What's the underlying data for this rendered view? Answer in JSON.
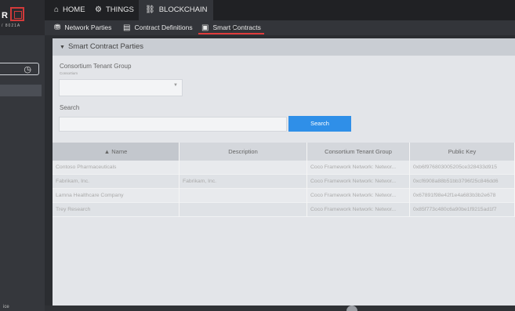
{
  "brand": {
    "letter": "R",
    "subtitle": "/ 8021A"
  },
  "top_nav": {
    "tabs": [
      {
        "label": "HOME",
        "icon": "home-icon",
        "glyph": "⌂"
      },
      {
        "label": "THINGS",
        "icon": "things-icon",
        "glyph": "⚙"
      },
      {
        "label": "BLOCKCHAIN",
        "icon": "blockchain-icon",
        "glyph": "⛓"
      }
    ]
  },
  "sub_nav": {
    "tabs": [
      {
        "label": "Network Parties",
        "icon": "network-parties-icon",
        "glyph": "⛃"
      },
      {
        "label": "Contract Definitions",
        "icon": "contract-definitions-icon",
        "glyph": "▤"
      },
      {
        "label": "Smart Contracts",
        "icon": "smart-contracts-icon",
        "glyph": "▣"
      }
    ]
  },
  "section": {
    "title": "Smart Contract Parties"
  },
  "consortium": {
    "label": "Consortium Tenant Group",
    "sublabel": "Consortium",
    "value": ""
  },
  "search": {
    "label": "Search",
    "value": "",
    "button": "Search"
  },
  "table": {
    "columns": [
      "Name",
      "Description",
      "Consortium Tenant Group",
      "Public Key"
    ],
    "rows": [
      [
        "Contoso Pharmaceuticals",
        "",
        "Coco Framework Network: Networ...",
        "0xb6f976803005205ce328433d915"
      ],
      [
        "Fabrikam, Inc.",
        "Fabrikam, Inc.",
        "Coco Framework Network: Networ...",
        "0xcf6908a88b51bb3796f25c846dd6"
      ],
      [
        "Lamna Healthcare Company",
        "",
        "Coco Framework Network: Networ...",
        "0x67891f98e42f1e4a683b3b2e678"
      ],
      [
        "Trey Research",
        "",
        "Coco Framework Network: Networ...",
        "0x85f773c480c6a90be1f9215ad1f7"
      ]
    ]
  },
  "rail": {
    "bottom_text": "ice"
  },
  "colors": {
    "accent": "#2f8fe8",
    "brand_red": "#e03c3c"
  }
}
